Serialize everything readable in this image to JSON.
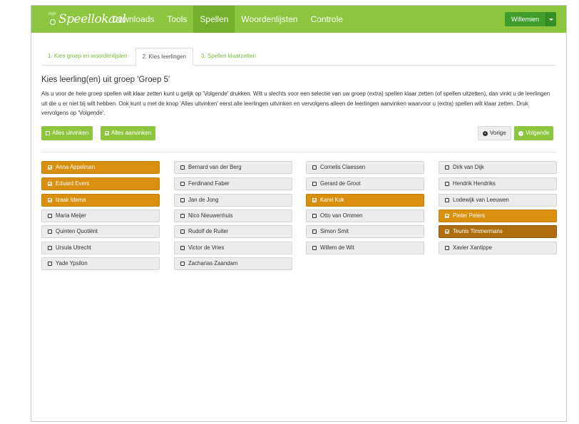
{
  "logo": {
    "prefix": "mijn",
    "text": "Speellokaal"
  },
  "nav": {
    "items": [
      {
        "label": "Downloads",
        "active": false
      },
      {
        "label": "Tools",
        "active": false
      },
      {
        "label": "Spellen",
        "active": true
      },
      {
        "label": "Woordenlijsten",
        "active": false
      },
      {
        "label": "Controle",
        "active": false
      }
    ]
  },
  "user": {
    "name": "Willemien"
  },
  "tabs": [
    {
      "label": "1. Kies groep en woordenlijsten",
      "active": false
    },
    {
      "label": "2. Kies leerlingen",
      "active": true
    },
    {
      "label": "3. Spellen klaarzetten",
      "active": false
    }
  ],
  "heading": "Kies leerling(en) uit groep 'Groep 5'",
  "description": "Als u voor de hele groep spellen wilt klaar zetten kunt u gelijk op 'Volgende' drukken. Wilt u slechts voor een selectie van uw groep (extra) spellen klaar zetten (of spellen uitzetten), dan vinkt u de leerlingen uit die u er niet bij wilt hebben. Ook kunt u met de knop 'Alles uitvinken' eerst alle leerlingen uitvinken en vervolgens alleen de leerlingen aanvinken waarvoor u (extra) spellen wilt klaar zetten. Druk vervolgens op 'Volgende'.",
  "buttons": {
    "uncheck_all": "Alles uitvinken",
    "check_all": "Alles aanvinken",
    "prev": "Vorige",
    "next": "Volgende"
  },
  "colors": {
    "green": "#8cc63f",
    "orange": "#d9900f",
    "dark_orange": "#b06d0d"
  },
  "students": [
    {
      "name": "Anna Appelman",
      "checked": true
    },
    {
      "name": "Bernard van der Berg",
      "checked": false
    },
    {
      "name": "Cornelis Claessen",
      "checked": false
    },
    {
      "name": "Dirk van Dijk",
      "checked": false
    },
    {
      "name": "Eduard Evers",
      "checked": true
    },
    {
      "name": "Ferdinand Faber",
      "checked": false
    },
    {
      "name": "Gerard de Groot",
      "checked": false
    },
    {
      "name": "Hendrik Hendriks",
      "checked": false
    },
    {
      "name": "Izaak Idema",
      "checked": true
    },
    {
      "name": "Jan de Jong",
      "checked": false
    },
    {
      "name": "Karel Kok",
      "checked": true
    },
    {
      "name": "Lodewijk van Leeuwen",
      "checked": false
    },
    {
      "name": "Maria Meijer",
      "checked": false
    },
    {
      "name": "Nico Nieuwenhuis",
      "checked": false
    },
    {
      "name": "Otto van Ommen",
      "checked": false
    },
    {
      "name": "Pieter Peters",
      "checked": true
    },
    {
      "name": "Quinten Quotiënt",
      "checked": false
    },
    {
      "name": "Rudolf de Ruiter",
      "checked": false
    },
    {
      "name": "Simon Smit",
      "checked": false
    },
    {
      "name": "Teunis Timmermans",
      "checked": true,
      "hover": true
    },
    {
      "name": "Ursula Utrecht",
      "checked": false
    },
    {
      "name": "Victor de Vries",
      "checked": false
    },
    {
      "name": "Willem de Wit",
      "checked": false
    },
    {
      "name": "Xavier Xantippe",
      "checked": false
    },
    {
      "name": "Yade Ypsilon",
      "checked": false
    },
    {
      "name": "Zacharias Zaandam",
      "checked": false
    }
  ]
}
